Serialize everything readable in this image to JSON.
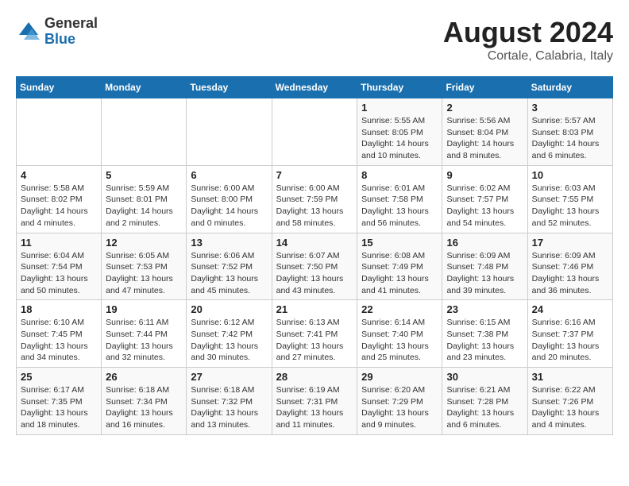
{
  "logo": {
    "general": "General",
    "blue": "Blue"
  },
  "title": {
    "month": "August 2024",
    "location": "Cortale, Calabria, Italy"
  },
  "weekdays": [
    "Sunday",
    "Monday",
    "Tuesday",
    "Wednesday",
    "Thursday",
    "Friday",
    "Saturday"
  ],
  "weeks": [
    [
      {
        "day": "",
        "info": ""
      },
      {
        "day": "",
        "info": ""
      },
      {
        "day": "",
        "info": ""
      },
      {
        "day": "",
        "info": ""
      },
      {
        "day": "1",
        "info": "Sunrise: 5:55 AM\nSunset: 8:05 PM\nDaylight: 14 hours\nand 10 minutes."
      },
      {
        "day": "2",
        "info": "Sunrise: 5:56 AM\nSunset: 8:04 PM\nDaylight: 14 hours\nand 8 minutes."
      },
      {
        "day": "3",
        "info": "Sunrise: 5:57 AM\nSunset: 8:03 PM\nDaylight: 14 hours\nand 6 minutes."
      }
    ],
    [
      {
        "day": "4",
        "info": "Sunrise: 5:58 AM\nSunset: 8:02 PM\nDaylight: 14 hours\nand 4 minutes."
      },
      {
        "day": "5",
        "info": "Sunrise: 5:59 AM\nSunset: 8:01 PM\nDaylight: 14 hours\nand 2 minutes."
      },
      {
        "day": "6",
        "info": "Sunrise: 6:00 AM\nSunset: 8:00 PM\nDaylight: 14 hours\nand 0 minutes."
      },
      {
        "day": "7",
        "info": "Sunrise: 6:00 AM\nSunset: 7:59 PM\nDaylight: 13 hours\nand 58 minutes."
      },
      {
        "day": "8",
        "info": "Sunrise: 6:01 AM\nSunset: 7:58 PM\nDaylight: 13 hours\nand 56 minutes."
      },
      {
        "day": "9",
        "info": "Sunrise: 6:02 AM\nSunset: 7:57 PM\nDaylight: 13 hours\nand 54 minutes."
      },
      {
        "day": "10",
        "info": "Sunrise: 6:03 AM\nSunset: 7:55 PM\nDaylight: 13 hours\nand 52 minutes."
      }
    ],
    [
      {
        "day": "11",
        "info": "Sunrise: 6:04 AM\nSunset: 7:54 PM\nDaylight: 13 hours\nand 50 minutes."
      },
      {
        "day": "12",
        "info": "Sunrise: 6:05 AM\nSunset: 7:53 PM\nDaylight: 13 hours\nand 47 minutes."
      },
      {
        "day": "13",
        "info": "Sunrise: 6:06 AM\nSunset: 7:52 PM\nDaylight: 13 hours\nand 45 minutes."
      },
      {
        "day": "14",
        "info": "Sunrise: 6:07 AM\nSunset: 7:50 PM\nDaylight: 13 hours\nand 43 minutes."
      },
      {
        "day": "15",
        "info": "Sunrise: 6:08 AM\nSunset: 7:49 PM\nDaylight: 13 hours\nand 41 minutes."
      },
      {
        "day": "16",
        "info": "Sunrise: 6:09 AM\nSunset: 7:48 PM\nDaylight: 13 hours\nand 39 minutes."
      },
      {
        "day": "17",
        "info": "Sunrise: 6:09 AM\nSunset: 7:46 PM\nDaylight: 13 hours\nand 36 minutes."
      }
    ],
    [
      {
        "day": "18",
        "info": "Sunrise: 6:10 AM\nSunset: 7:45 PM\nDaylight: 13 hours\nand 34 minutes."
      },
      {
        "day": "19",
        "info": "Sunrise: 6:11 AM\nSunset: 7:44 PM\nDaylight: 13 hours\nand 32 minutes."
      },
      {
        "day": "20",
        "info": "Sunrise: 6:12 AM\nSunset: 7:42 PM\nDaylight: 13 hours\nand 30 minutes."
      },
      {
        "day": "21",
        "info": "Sunrise: 6:13 AM\nSunset: 7:41 PM\nDaylight: 13 hours\nand 27 minutes."
      },
      {
        "day": "22",
        "info": "Sunrise: 6:14 AM\nSunset: 7:40 PM\nDaylight: 13 hours\nand 25 minutes."
      },
      {
        "day": "23",
        "info": "Sunrise: 6:15 AM\nSunset: 7:38 PM\nDaylight: 13 hours\nand 23 minutes."
      },
      {
        "day": "24",
        "info": "Sunrise: 6:16 AM\nSunset: 7:37 PM\nDaylight: 13 hours\nand 20 minutes."
      }
    ],
    [
      {
        "day": "25",
        "info": "Sunrise: 6:17 AM\nSunset: 7:35 PM\nDaylight: 13 hours\nand 18 minutes."
      },
      {
        "day": "26",
        "info": "Sunrise: 6:18 AM\nSunset: 7:34 PM\nDaylight: 13 hours\nand 16 minutes."
      },
      {
        "day": "27",
        "info": "Sunrise: 6:18 AM\nSunset: 7:32 PM\nDaylight: 13 hours\nand 13 minutes."
      },
      {
        "day": "28",
        "info": "Sunrise: 6:19 AM\nSunset: 7:31 PM\nDaylight: 13 hours\nand 11 minutes."
      },
      {
        "day": "29",
        "info": "Sunrise: 6:20 AM\nSunset: 7:29 PM\nDaylight: 13 hours\nand 9 minutes."
      },
      {
        "day": "30",
        "info": "Sunrise: 6:21 AM\nSunset: 7:28 PM\nDaylight: 13 hours\nand 6 minutes."
      },
      {
        "day": "31",
        "info": "Sunrise: 6:22 AM\nSunset: 7:26 PM\nDaylight: 13 hours\nand 4 minutes."
      }
    ]
  ]
}
